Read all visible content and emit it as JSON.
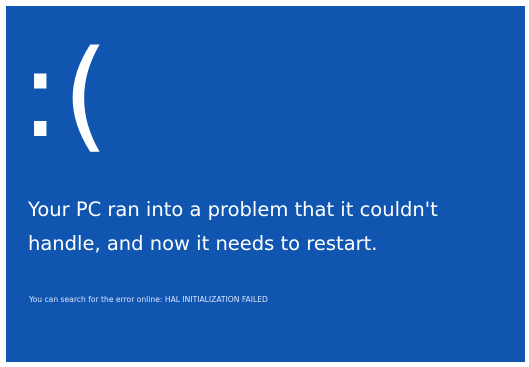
{
  "bsod": {
    "face": ":(",
    "message": "Your PC ran into a problem that it couldn't\nhandle, and now it needs to restart.",
    "error_prefix": "You can search for the error online: ",
    "error_code": "HAL INITIALIZATION FAILED"
  },
  "colors": {
    "background": "#1055b0",
    "text": "#ffffff"
  }
}
